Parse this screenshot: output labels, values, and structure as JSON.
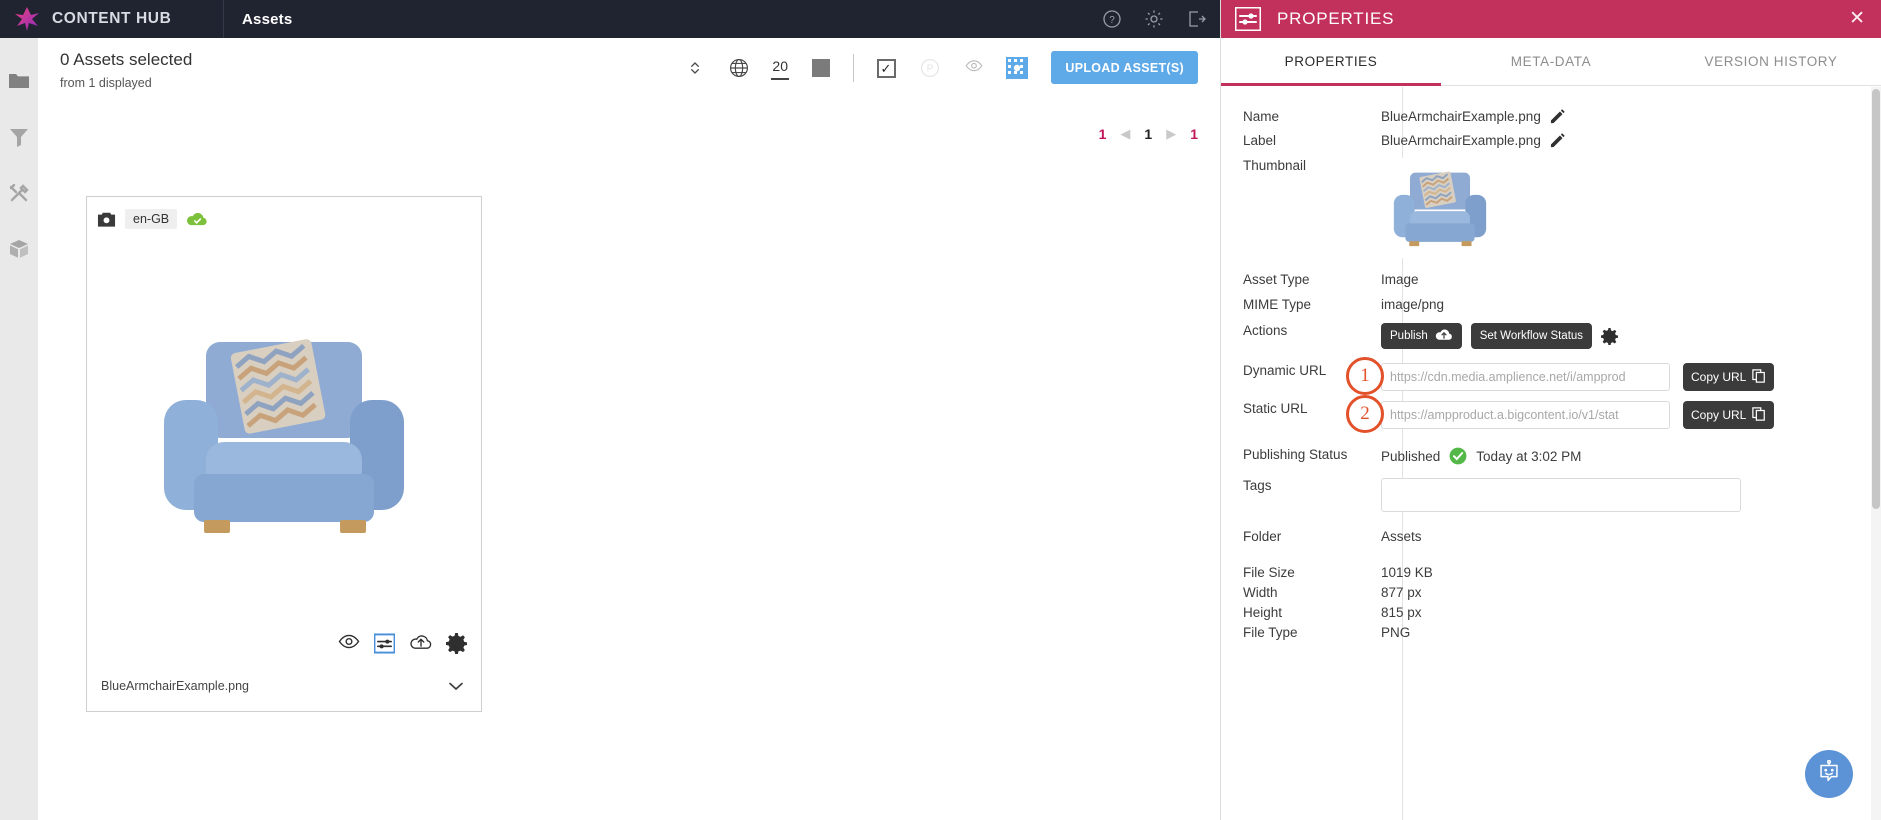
{
  "topbar": {
    "brand": "CONTENT HUB",
    "section_title": "Assets",
    "icons": {
      "help": "help-circle-icon",
      "settings": "gear-icon",
      "logout": "logout-icon"
    }
  },
  "sidebar": {
    "items": [
      {
        "name": "folder",
        "label": "Folders"
      },
      {
        "name": "filter",
        "label": "Filters"
      },
      {
        "name": "tools",
        "label": "Tools"
      },
      {
        "name": "box",
        "label": "Packages"
      }
    ]
  },
  "content": {
    "selected_title": "0 Assets selected",
    "selected_sub": "from 1 displayed",
    "toolbar": {
      "sort_icon": "sort-updown-icon",
      "locale_icon": "globe-icon",
      "page_size": "20",
      "size_swatch_icon": "square-icon",
      "select_all_icon": "checkbox-checked-icon",
      "publish_filter_icon": "p-circle-icon",
      "preview_icon": "eye-icon",
      "grid_view_icon": "grid-view-icon"
    },
    "upload_label": "UPLOAD ASSET(S)",
    "pager": {
      "first": "1",
      "current": "1",
      "last": "1"
    }
  },
  "card": {
    "locale": "en-GB",
    "camera_icon": "camera-icon",
    "publish_icon": "cloud-check-icon",
    "filename": "BlueArmchairExample.png",
    "icons": [
      "eye-icon",
      "properties-icon",
      "upload-cloud-icon",
      "gear-icon"
    ],
    "expand_icon": "chevron-down-icon"
  },
  "panel": {
    "header_title": "PROPERTIES",
    "header_icon": "properties-panel-icon",
    "close_icon": "close-icon",
    "tabs": [
      {
        "label": "PROPERTIES",
        "active": true
      },
      {
        "label": "META-DATA",
        "active": false
      },
      {
        "label": "VERSION HISTORY",
        "active": false
      }
    ],
    "fields": {
      "name_label": "Name",
      "name_value": "BlueArmchairExample.png",
      "label_label": "Label",
      "label_value": "BlueArmchairExample.png",
      "thumbnail_label": "Thumbnail",
      "asset_type_label": "Asset Type",
      "asset_type_value": "Image",
      "mime_type_label": "MIME Type",
      "mime_type_value": "image/png",
      "actions_label": "Actions",
      "publish_button": "Publish",
      "workflow_button": "Set Workflow Status",
      "actions_gear_icon": "gear-icon",
      "dynamic_url_label": "Dynamic URL",
      "dynamic_url_placeholder": "https://cdn.media.amplience.net/i/ampprod",
      "static_url_label": "Static URL",
      "static_url_placeholder": "https://ampproduct.a.bigcontent.io/v1/stat",
      "copy_url_label": "Copy URL",
      "copy_icon": "copy-icon",
      "annotation_1": "1",
      "annotation_2": "2",
      "publishing_status_label": "Publishing Status",
      "publishing_status_value": "Published",
      "publishing_status_icon": "check-circle-green-icon",
      "publishing_status_time": "Today at 3:02 PM",
      "tags_label": "Tags",
      "tags_value": "",
      "folder_label": "Folder",
      "folder_value": "Assets",
      "file_size_label": "File Size",
      "file_size_value": "1019 KB",
      "width_label": "Width",
      "width_value": "877 px",
      "height_label": "Height",
      "height_value": "815 px",
      "file_type_label": "File Type",
      "file_type_value": "PNG"
    },
    "chat_icon": "chatbot-icon"
  },
  "colors": {
    "topbar": "#1f2430",
    "panel_header": "#c2315c",
    "accent_pink": "#c2185b",
    "upload_blue": "#5ea9e8",
    "annotation_orange": "#e2512a",
    "published_green": "#53b848"
  }
}
